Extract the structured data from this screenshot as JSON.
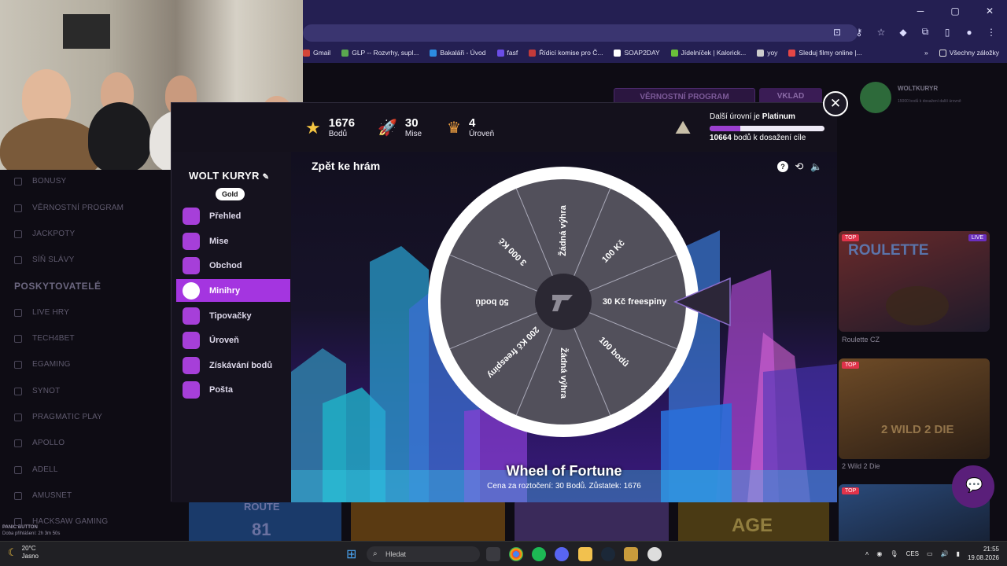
{
  "browser": {
    "window_controls": [
      "─",
      "▢",
      "✕"
    ],
    "bookmarks": [
      {
        "label": "Gmail",
        "color": "#d44638"
      },
      {
        "label": "GLP -- Rozvrhy, supl...",
        "color": "#5aa84f"
      },
      {
        "label": "Bakaláři - Úvod",
        "color": "#2c8be0"
      },
      {
        "label": "fasf",
        "color": "#6b4de6"
      },
      {
        "label": "Řídicí komise pro Č...",
        "color": "#c23a3a"
      },
      {
        "label": "SOAP2DAY",
        "color": "#ffffff"
      },
      {
        "label": "Jídelníček | Kalorick...",
        "color": "#6bbf3a"
      },
      {
        "label": "yoy",
        "color": "#cccccc"
      },
      {
        "label": "Sleduj filmy online |...",
        "color": "#e54646"
      }
    ],
    "bookmarks_overflow": "»",
    "all_bookmarks": "Všechny záložky"
  },
  "site": {
    "sidebar_items": [
      "BONUSY",
      "VĚRNOSTNÍ PROGRAM",
      "JACKPOTY",
      "SÍŇ SLÁVY"
    ],
    "providers_heading": "POSKYTOVATELÉ",
    "providers": [
      "LIVE HRY",
      "TECH4BET",
      "EGAMING",
      "SYNOT",
      "PRAGMATIC PLAY",
      "APOLLO",
      "ADELL",
      "AMUSNET",
      "HACKSAW GAMING"
    ],
    "panic_label": "PANIC BUTTON",
    "panic_sub": "Doba přihlášení: 2h 3m 50s",
    "header_loyalty": "VĚRNOSTNÍ PROGRAM",
    "header_deposit": "VKLAD",
    "user_name": "WOLTKURYR",
    "user_sub": "15000 bodů k dosažení další úrovně",
    "cards": [
      {
        "badge": "TOP",
        "title": "Roulette CZ",
        "art": "ROULETTE",
        "live": "LIVE"
      },
      {
        "badge": "TOP",
        "title": "2 Wild 2 Die",
        "art": "2 WILD 2 DIE"
      },
      {
        "badge": "TOP",
        "title": ""
      }
    ],
    "bottom_art": [
      "ROUTE",
      "81",
      "AGE"
    ]
  },
  "modal": {
    "stats": [
      {
        "value": "1676",
        "label": "Bodů"
      },
      {
        "value": "30",
        "label": "Mise"
      },
      {
        "value": "4",
        "label": "Úroveň"
      }
    ],
    "next_level_prefix": "Další úrovní je ",
    "next_level_name": "Platinum",
    "next_level_progress": 0.27,
    "points_needed": "10664",
    "points_needed_suffix": " bodů k dosažení cíle",
    "profile_name": "WOLT KURYR",
    "tier": "Gold",
    "menu": [
      {
        "label": "Přehled",
        "active": false
      },
      {
        "label": "Mise",
        "active": false
      },
      {
        "label": "Obchod",
        "active": false
      },
      {
        "label": "Minihry",
        "active": true
      },
      {
        "label": "Tipovačky",
        "active": false
      },
      {
        "label": "Úroveň",
        "active": false
      },
      {
        "label": "Získávání bodů",
        "active": false
      },
      {
        "label": "Pošta",
        "active": false
      }
    ],
    "back": "Zpět ke hrám",
    "game_title": "Wheel of Fortune",
    "game_cost": "Cena za roztočení: 30 Bodů. Zůstatek: 1676",
    "wheel_segments": [
      "Žádná výhra",
      "100 Kč",
      "30 Kč freespiny",
      "100 bodů",
      "Žádná výhra",
      "200 Kč freespiny",
      "50 bodů",
      "3 000 Kč"
    ]
  },
  "taskbar": {
    "temp": "20°C",
    "weather": "Jasno",
    "search_placeholder": "Hledat",
    "lang": "CES",
    "time": "21:55",
    "date": "19.08.2026"
  }
}
